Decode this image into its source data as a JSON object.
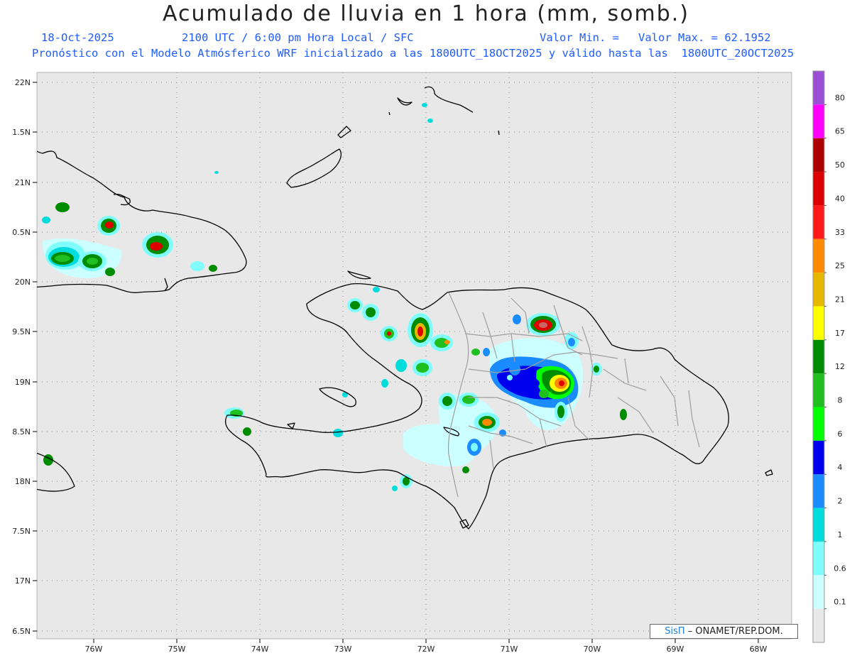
{
  "header": {
    "title": "Acumulado de lluvia en 1 hora (mm, somb.)",
    "date": "18-Oct-2025",
    "time_info": "2100 UTC / 6:00 pm Hora Local / SFC",
    "min_label": "Valor Min. =",
    "max_label": "Valor Max. = 62.1952",
    "forecast_info": "Pronóstico con el Modelo Atmósferico WRF inicializado a las 1800UTC_18OCT2025 y válido hasta las  1800UTC_20OCT2025"
  },
  "axes": {
    "lat_labels": [
      "22N",
      "1.5N",
      "21N",
      "0.5N",
      "20N",
      "9.5N",
      "19N",
      "8.5N",
      "18N",
      "7.5N",
      "17N",
      "6.5N"
    ],
    "lon_labels": [
      "76W",
      "75W",
      "74W",
      "73W",
      "72W",
      "71W",
      "70W",
      "69W",
      "68W"
    ]
  },
  "legend": {
    "labels": [
      "80",
      "65",
      "50",
      "40",
      "33",
      "25",
      "21",
      "17",
      "12",
      "8",
      "6",
      "4",
      "2",
      "1",
      "0.6",
      "0.1"
    ],
    "colors": [
      "#9b4fd6",
      "#ff00ff",
      "#ad0000",
      "#dd0000",
      "#ff1a1a",
      "#ff8a00",
      "#e6b800",
      "#ffff00",
      "#008c00",
      "#1fbf1f",
      "#00ff00",
      "#0000ee",
      "#1a8cff",
      "#00dcdc",
      "#7ffcfc",
      "#ccffff",
      "#e8e8e8"
    ]
  },
  "credit": {
    "brand": "SisΠ",
    "text": "– ONAMET/REP.DOM."
  },
  "colors": {
    "background": "#e8e8e8",
    "coast": "#000000",
    "provinces": "#9e9e9e",
    "text_blue": "#1f5cff"
  }
}
